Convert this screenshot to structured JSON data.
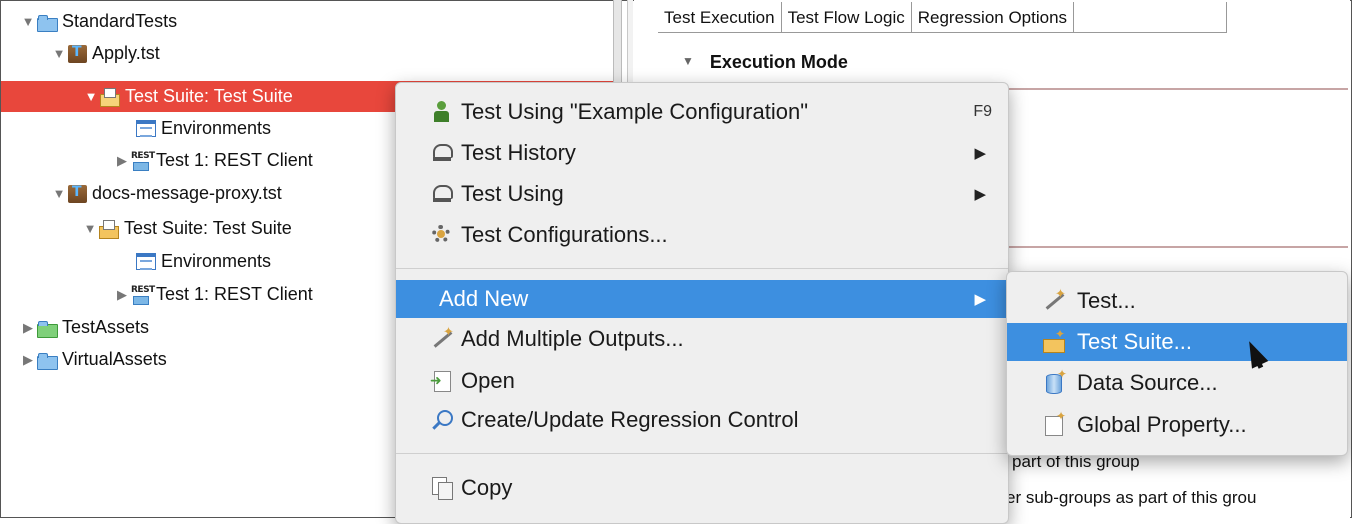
{
  "tree": {
    "rows": [
      {
        "label": "StandardTests",
        "icon": "folder-icon"
      },
      {
        "label": "Apply.tst",
        "icon": "tst-file-icon"
      },
      {
        "label": "Test Suite: Test Suite",
        "icon": "test-suite-icon",
        "selected": true
      },
      {
        "label": "Environments",
        "icon": "environments-icon"
      },
      {
        "label": "Test 1: REST Client",
        "icon": "rest-client-icon"
      },
      {
        "label": "docs-message-proxy.tst",
        "icon": "tst-file-icon"
      },
      {
        "label": "Test Suite: Test Suite",
        "icon": "test-suite-icon"
      },
      {
        "label": "Environments",
        "icon": "environments-icon"
      },
      {
        "label": "Test 1: REST Client",
        "icon": "rest-client-icon"
      },
      {
        "label": "TestAssets",
        "icon": "folder-icon"
      },
      {
        "label": "VirtualAssets",
        "icon": "folder-icon"
      }
    ],
    "rest_icon_text": "REST"
  },
  "right_pane": {
    "tabs": [
      "Test Execution",
      "Test Flow Logic",
      "Regression Options"
    ],
    "section_title": "Execution Mode",
    "partial_text_1": "part of this group",
    "partial_text_2": "er sub-groups as part of this grou"
  },
  "context_menu": {
    "items": [
      {
        "label": "Test Using \"Example Configuration\"",
        "accelerator": "F9",
        "icon": "run-test-icon"
      },
      {
        "label": "Test History",
        "icon": "test-history-icon",
        "submenu": true
      },
      {
        "label": "Test Using",
        "icon": "test-using-icon",
        "submenu": true
      },
      {
        "label": "Test Configurations...",
        "icon": "configurations-icon"
      },
      {
        "label": "Add New",
        "submenu": true,
        "highlighted": true
      },
      {
        "label": "Add Multiple Outputs...",
        "icon": "add-outputs-icon"
      },
      {
        "label": "Open",
        "icon": "open-icon"
      },
      {
        "label": "Create/Update Regression Control",
        "icon": "regression-control-icon"
      },
      {
        "label": "Copy",
        "icon": "copy-icon"
      }
    ],
    "submenu_arrow": "▶"
  },
  "add_new_submenu": {
    "items": [
      {
        "label": "Test...",
        "icon": "new-test-icon"
      },
      {
        "label": "Test Suite...",
        "icon": "new-test-suite-icon",
        "highlighted": true
      },
      {
        "label": "Data Source...",
        "icon": "new-data-source-icon"
      },
      {
        "label": "Global Property...",
        "icon": "new-global-property-icon"
      }
    ]
  },
  "colors": {
    "selection_red": "#e8473c",
    "menu_highlight": "#3d8fe0",
    "menu_background": "#efefef"
  }
}
